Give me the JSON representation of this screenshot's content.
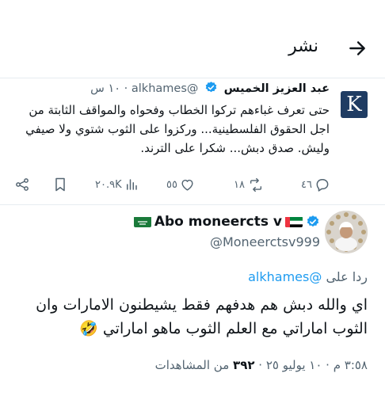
{
  "header": {
    "title": "نشر",
    "back_icon": "arrow-right-icon"
  },
  "quoted_post": {
    "avatar_letter": "K",
    "name": "عبد العزيز الخميس",
    "handle": "@alkhames",
    "time": "١٠ س",
    "text": "حتى تعرف غباءهم تركوا الخطاب وفحواه والمواقف الثابتة من اجل الحقوق الفلسطينية... وركزوا على الثوب شتوي ولا صيفي وليش. صدق دبش... شكرا على الترند.",
    "actions": {
      "replies": "٤٦",
      "reposts": "١٨",
      "likes": "٥٥",
      "views": "٢٠.٩K"
    }
  },
  "reply_post": {
    "name": "Abo moneercts v",
    "handle": "@Moneerctsv999",
    "reply_to_label": "ردا على",
    "reply_to_handle": "@alkhames",
    "text": "اي والله دبش هم هدفهم فقط يشيطنون الامارات وان الثوب اماراتي مع العلم الثوب ماهو اماراتي 🤣",
    "timestamp": "٣:٥٨ م · ١٠ يوليو ٢٥",
    "views_count": "٣٩٢",
    "views_label": "من المشاهدات"
  },
  "colors": {
    "accent": "#1d9bf0",
    "muted": "#536471",
    "text": "#0f1419",
    "divider": "#e6ecf0"
  }
}
